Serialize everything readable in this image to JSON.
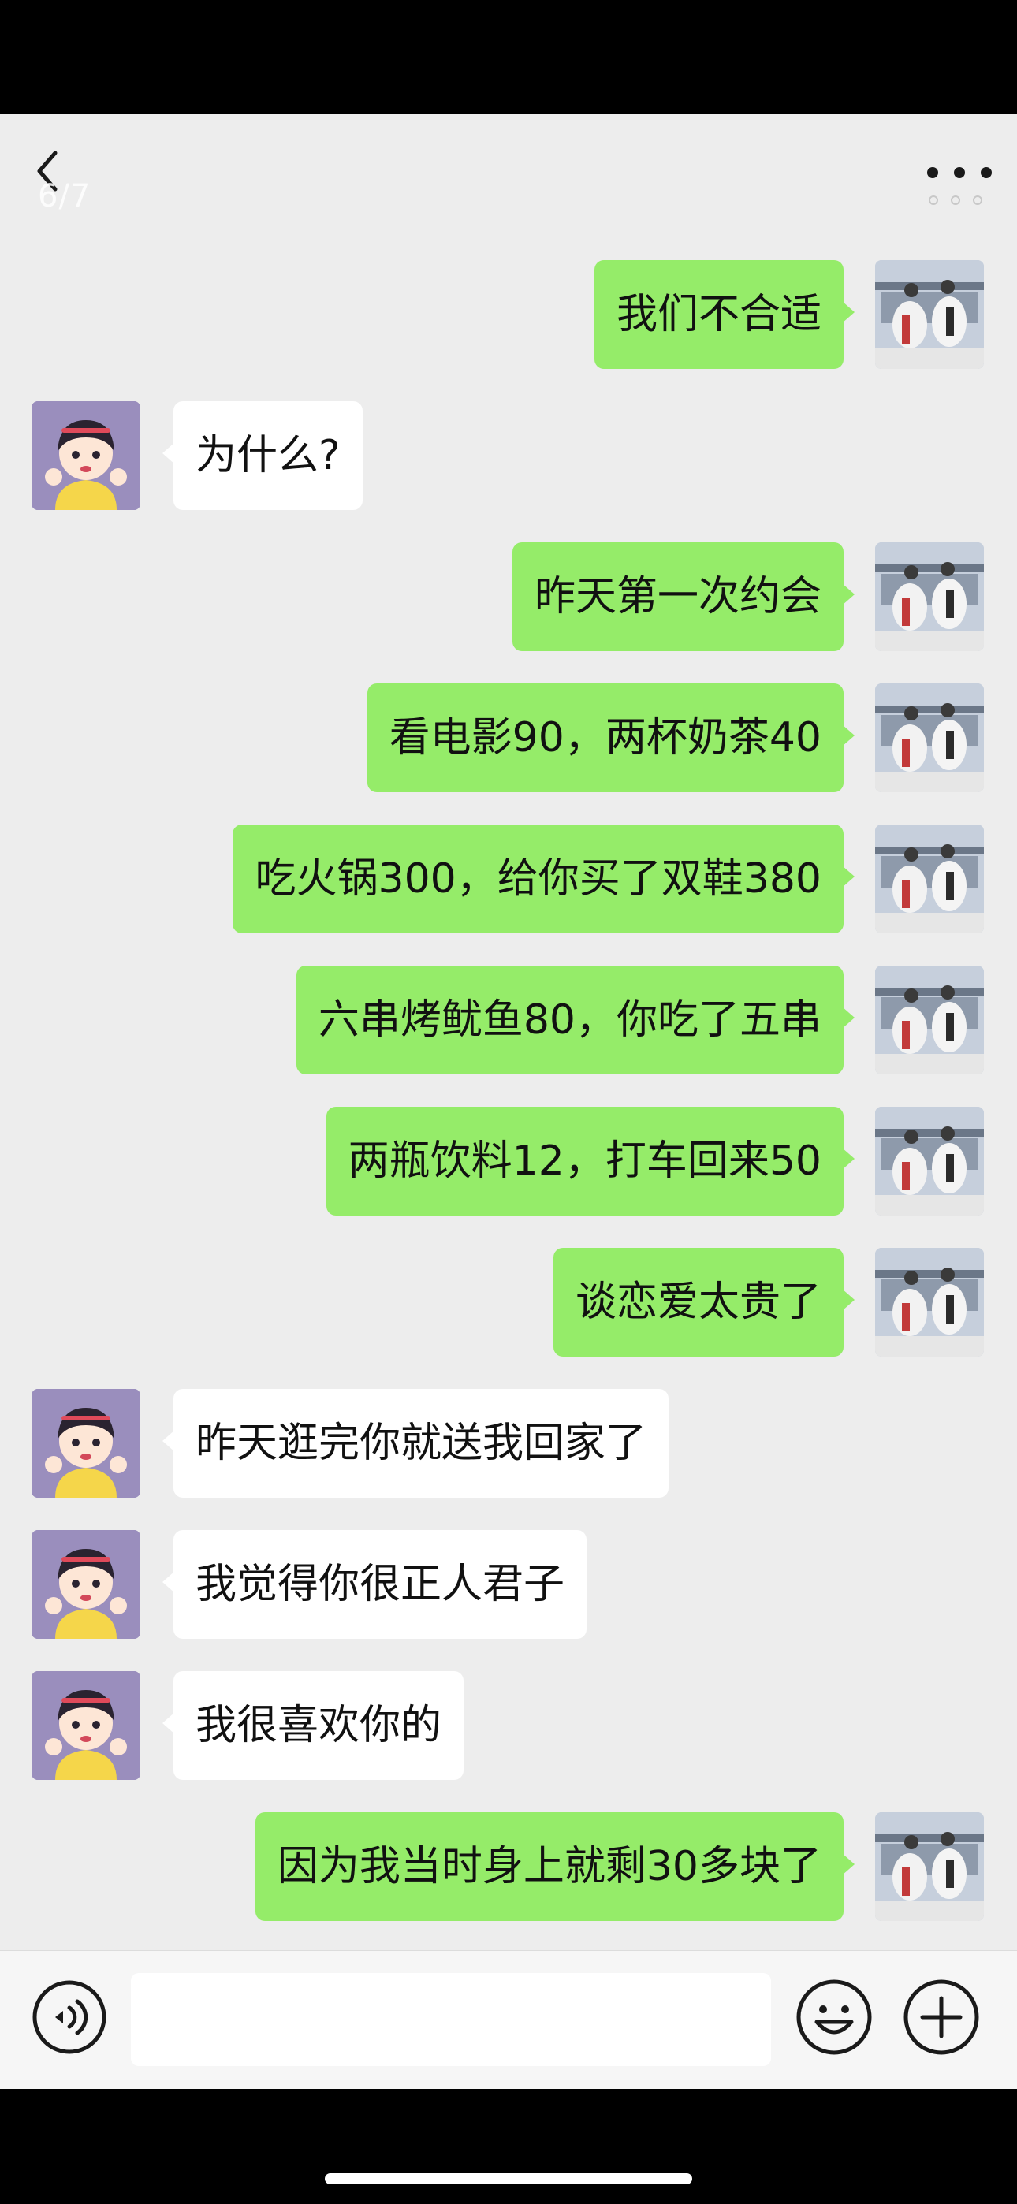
{
  "nav": {
    "back_icon": "chevron-left-icon",
    "counter": "6/7",
    "more_icon": "more-dots-icon"
  },
  "colors": {
    "outgoing_bubble": "#95ec69",
    "incoming_bubble": "#ffffff",
    "background": "#ededed"
  },
  "messages": [
    {
      "side": "me",
      "text": "我们不合适"
    },
    {
      "side": "them",
      "text": "为什么?"
    },
    {
      "side": "me",
      "text": "昨天第一次约会"
    },
    {
      "side": "me",
      "text": "看电影90，两杯奶茶40"
    },
    {
      "side": "me",
      "text": "吃火锅300，给你买了双鞋380"
    },
    {
      "side": "me",
      "text": "六串烤鱿鱼80，你吃了五串"
    },
    {
      "side": "me",
      "text": "两瓶饮料12，打车回来50"
    },
    {
      "side": "me",
      "text": "谈恋爱太贵了"
    },
    {
      "side": "them",
      "text": "昨天逛完你就送我回家了"
    },
    {
      "side": "them",
      "text": "我觉得你很正人君子"
    },
    {
      "side": "them",
      "text": "我很喜欢你的"
    },
    {
      "side": "me",
      "text": "因为我当时身上就剩30多块了"
    }
  ],
  "input_bar": {
    "voice_icon": "voice-icon",
    "text_value": "",
    "emoji_icon": "emoji-icon",
    "plus_icon": "plus-icon"
  }
}
